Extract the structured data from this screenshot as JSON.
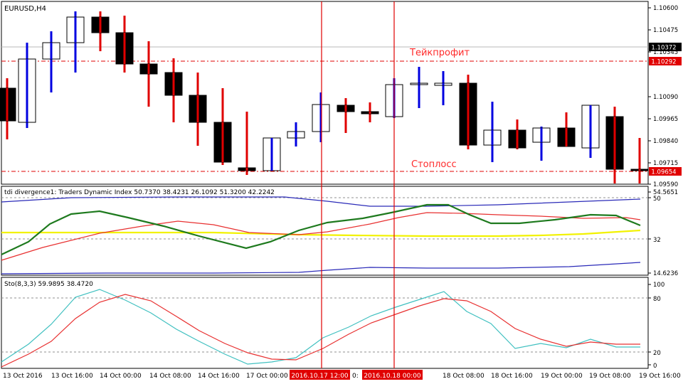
{
  "colors": {
    "background": "#ffffff",
    "frame": "#000000",
    "bull_candle_fill": "#ffffff",
    "bear_candle_fill": "#000000",
    "bull_wick": "#0000e0",
    "bear_wick": "#e00000",
    "level_line": "#e00000",
    "vertical_marker": "#e00000",
    "tp_label": "#ff2a2a",
    "tdi_green": "#1e7a1e",
    "tdi_red": "#e83030",
    "tdi_blue": "#2a2ab8",
    "tdi_yellow": "#f2f200",
    "sto_main": "#40c0c0",
    "sto_signal": "#e83030",
    "price_tag_red": "#e00000",
    "price_tag_black": "#000000"
  },
  "main": {
    "symbol_label": "EURUSD,H4",
    "take_profit_label": "Тейкпрофит",
    "stop_loss_label": "Стоплосс",
    "price_axis": [
      "1.10600",
      "1.10475",
      "1.10345",
      "1.10090",
      "1.09965",
      "1.09840",
      "1.09715",
      "1.09590"
    ],
    "current_price": "1.10372",
    "take_profit_price": "1.10292",
    "stop_loss_price": "1.09654"
  },
  "tdi": {
    "label": "tdi divergence1: Traders Dynamic Index 50.7370 38.4231 26.1092 51.3200 42.2242",
    "axis": [
      "54.5651",
      "50",
      "32",
      "14.6236"
    ]
  },
  "sto": {
    "label": "Sto(8,3,3) 59.9895 38.4720",
    "axis": [
      "100",
      "80",
      "20",
      "0"
    ]
  },
  "time_axis": {
    "labels": [
      "13 Oct 2016",
      "13 Oct 16:00",
      "14 Oct 00:00",
      "14 Oct 08:00",
      "14 Oct 16:00",
      "17 Oct 00:00",
      "",
      "",
      "18 Oct 08:00",
      "18 Oct 16:00",
      "19 Oct 00:00",
      "19 Oct 08:00",
      "19 Oct 16:00"
    ],
    "marker_1": "2016.10.17 12:00",
    "marker_2": "2016.10.18 00:00",
    "partial_label": "0:"
  }
}
